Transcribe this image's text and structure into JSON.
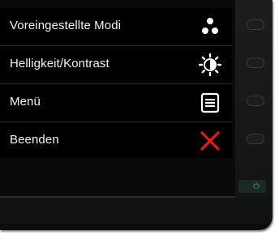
{
  "osd_menu": {
    "items": [
      {
        "label": "Voreingestellte Modi",
        "icon": "preset-modes-icon"
      },
      {
        "label": "Helligkeit/Kontrast",
        "icon": "brightness-contrast-icon"
      },
      {
        "label": "Menü",
        "icon": "menu-icon"
      },
      {
        "label": "Beenden",
        "icon": "exit-icon"
      }
    ]
  },
  "colors": {
    "exit_red": "#e41b1b",
    "text": "#f2f2f2",
    "osd_background": "#000000"
  }
}
